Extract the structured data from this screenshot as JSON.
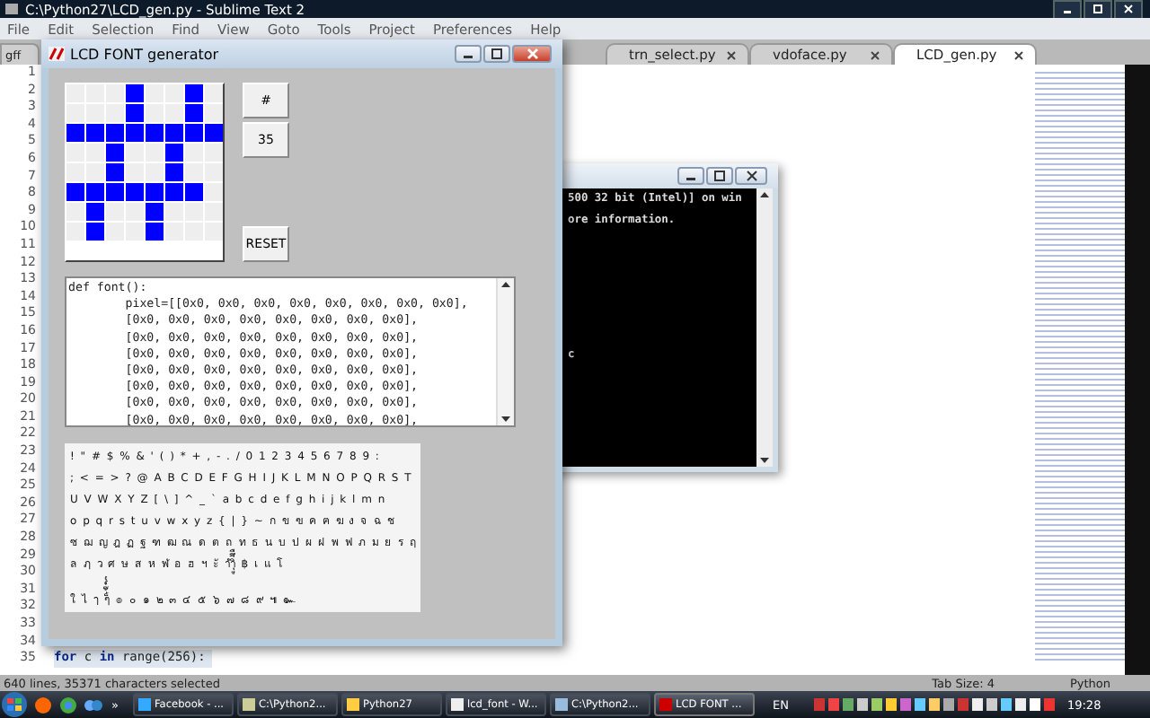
{
  "sublime": {
    "title": "C:\\Python27\\LCD_gen.py - Sublime Text 2",
    "menu": [
      "File",
      "Edit",
      "Selection",
      "Find",
      "View",
      "Goto",
      "Tools",
      "Project",
      "Preferences",
      "Help"
    ],
    "tabs": [
      {
        "label": "gff",
        "selected": false
      },
      {
        "label": "trn_select.py",
        "selected": false
      },
      {
        "label": "vdoface.py",
        "selected": false
      },
      {
        "label": "LCD_gen.py",
        "selected": true
      }
    ],
    "lines": [
      {
        "number": "1"
      },
      {
        "number": "2"
      },
      {
        "number": "3"
      },
      {
        "number": "4"
      },
      {
        "number": "5"
      },
      {
        "number": "6"
      },
      {
        "number": "7"
      },
      {
        "number": "8"
      },
      {
        "number": "9"
      },
      {
        "number": "10"
      },
      {
        "number": "11"
      },
      {
        "number": "12"
      },
      {
        "number": "13"
      },
      {
        "number": "14"
      },
      {
        "number": "15"
      },
      {
        "number": "16"
      },
      {
        "number": "17"
      },
      {
        "number": "18"
      },
      {
        "number": "19"
      },
      {
        "number": "20"
      },
      {
        "number": "21"
      },
      {
        "number": "22"
      },
      {
        "number": "23"
      },
      {
        "number": "24"
      },
      {
        "number": "25"
      },
      {
        "number": "26"
      },
      {
        "number": "27"
      },
      {
        "number": "28"
      },
      {
        "number": "29"
      },
      {
        "number": "30"
      },
      {
        "number": "31"
      },
      {
        "number": "32"
      },
      {
        "number": "33"
      },
      {
        "number": "34"
      },
      {
        "number": "35",
        "code": "**for** c **in** range(256):"
      }
    ],
    "status": {
      "selection": "640 lines, 35371 characters selected",
      "tab_size": "Tab Size: 4",
      "syntax": "Python"
    }
  },
  "console": {
    "lines": [
      "500 32 bit (Intel)] on win",
      "ore information."
    ],
    "cursor_text": "c"
  },
  "lcd_window": {
    "title": "LCD FONT generator",
    "grid": [
      [
        false,
        false,
        false,
        true,
        false,
        false,
        true,
        false
      ],
      [
        false,
        false,
        false,
        true,
        false,
        false,
        true,
        false
      ],
      [
        true,
        true,
        true,
        true,
        true,
        true,
        true,
        true
      ],
      [
        false,
        false,
        true,
        false,
        false,
        true,
        false,
        false
      ],
      [
        false,
        false,
        true,
        false,
        false,
        true,
        false,
        false
      ],
      [
        true,
        true,
        true,
        true,
        true,
        true,
        true,
        false
      ],
      [
        false,
        true,
        false,
        false,
        true,
        false,
        false,
        false
      ],
      [
        false,
        true,
        false,
        false,
        true,
        false,
        false,
        false
      ]
    ],
    "char_button": "#",
    "code_button": "35",
    "reset_button": "RESET",
    "code": [
      "def font():",
      "        pixel=[[0x0, 0x0, 0x0, 0x0, 0x0, 0x0, 0x0, 0x0],",
      "        [0x0, 0x0, 0x0, 0x0, 0x0, 0x0, 0x0, 0x0],",
      "        [0x0, 0x0, 0x0, 0x0, 0x0, 0x0, 0x0, 0x0],",
      "        [0x0, 0x0, 0x0, 0x0, 0x0, 0x0, 0x0, 0x0],",
      "        [0x0, 0x0, 0x0, 0x0, 0x0, 0x0, 0x0, 0x0],",
      "        [0x0, 0x0, 0x0, 0x0, 0x0, 0x0, 0x0, 0x0],",
      "        [0x0, 0x0, 0x0, 0x0, 0x0, 0x0, 0x0, 0x0],",
      "        [0x0, 0x0, 0x0, 0x0, 0x0, 0x0, 0x0, 0x0],"
    ],
    "char_rows": [
      "!\"#$%&'()*+,-./0123456789:",
      ";<=>?@ABCDEFGHIJKLMNOPQRST",
      "UVWXYZ[\\]^_`abcdefghijklmn",
      "opqrstuvwxyz{|}~กขฃคฅฆงจฉช",
      "ซฌญฎฏฐฑฒณดตถทธนบปผฝพฟภมยรฤ",
      "ลฦวศษสหฬอฮฯะัาำิีึืฺุู฿เแโ",
      "ใไๅๆ็่้๊๋์ํ๎๏๐๑๒๓๔๕๖๗๘๙๚๛"
    ]
  },
  "taskbar": {
    "buttons": [
      {
        "label": "Facebook - ...",
        "selected": false
      },
      {
        "label": "C:\\Python2...",
        "selected": false
      },
      {
        "label": "Python27",
        "selected": false
      },
      {
        "label": "lcd_font - W...",
        "selected": false
      },
      {
        "label": "C:\\Python2...",
        "selected": false
      },
      {
        "label": "LCD FONT ...",
        "selected": true
      }
    ],
    "overflow": "»",
    "language": "EN",
    "clock": "19:28"
  }
}
